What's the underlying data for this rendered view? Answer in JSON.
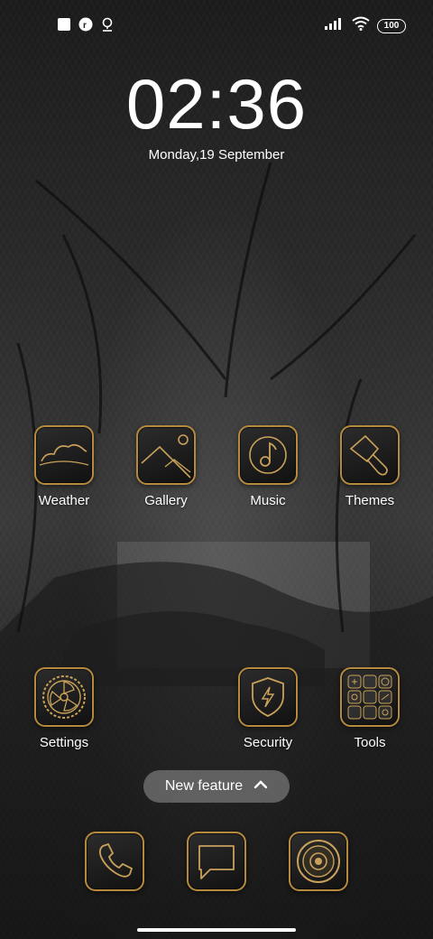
{
  "status_bar": {
    "left_icons": [
      "square-icon",
      "record-icon",
      "location-icon"
    ],
    "right_icons": [
      "signal-icon",
      "wifi-icon"
    ],
    "battery": "100"
  },
  "clock": {
    "time": "02:36",
    "date": "Monday,19 September"
  },
  "apps": {
    "weather": "Weather",
    "gallery": "Gallery",
    "music": "Music",
    "themes": "Themes",
    "settings": "Settings",
    "security": "Security",
    "tools": "Tools"
  },
  "new_feature": {
    "label": "New feature"
  },
  "dock": [
    "phone-icon",
    "messages-icon",
    "camera-icon"
  ],
  "colors": {
    "accent_gold": "#b58a3e"
  }
}
